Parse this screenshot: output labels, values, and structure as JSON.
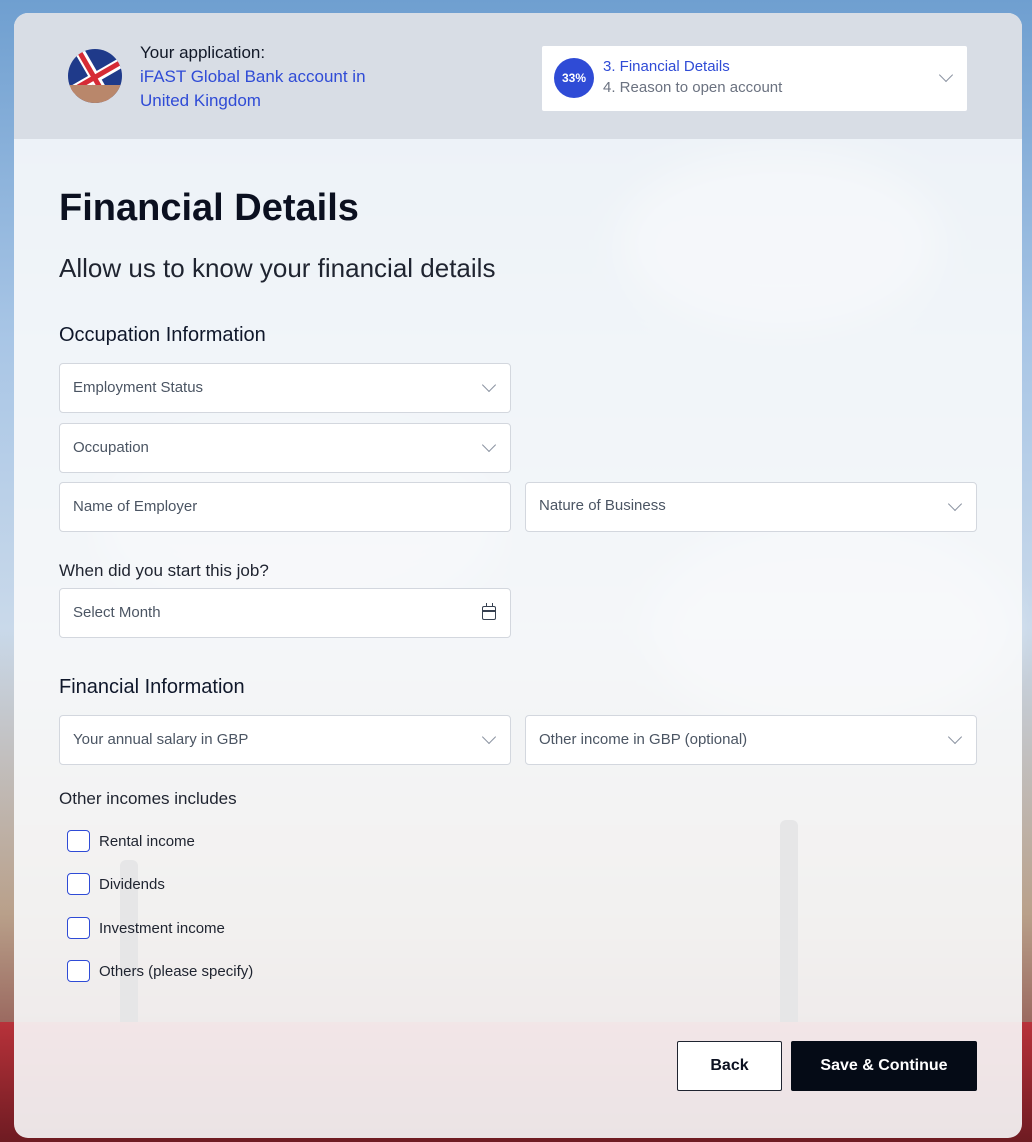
{
  "header": {
    "application_label": "Your application:",
    "application_name": "iFAST Global Bank account in United Kingdom",
    "progress": {
      "percent_label": "33%",
      "percent": 33,
      "current_step": "3. Financial Details",
      "next_step": "4. Reason to open account"
    }
  },
  "main": {
    "title": "Financial Details",
    "subtitle": "Allow us to know your financial details",
    "occupation_section": {
      "title": "Occupation Information",
      "employment_status_placeholder": "Employment Status",
      "occupation_placeholder": "Occupation",
      "employer_placeholder": "Name of Employer",
      "nature_of_business_placeholder": "Nature of Business",
      "start_job_question": "When did you start this job?",
      "select_month_placeholder": "Select Month"
    },
    "financial_section": {
      "title": "Financial Information",
      "annual_salary_placeholder": "Your annual salary in GBP",
      "other_income_placeholder": "Other income in GBP (optional)",
      "other_incomes_label": "Other incomes includes",
      "options": [
        {
          "label": "Rental income",
          "checked": false
        },
        {
          "label": "Dividends",
          "checked": false
        },
        {
          "label": "Investment income",
          "checked": false
        },
        {
          "label": "Others (please specify)",
          "checked": false
        }
      ]
    }
  },
  "actions": {
    "back_label": "Back",
    "save_label": "Save & Continue"
  },
  "colors": {
    "accent": "#2f4bd6",
    "primary_button": "#050b16"
  },
  "icons": [
    "uk-flag-icon",
    "chevron-down-icon",
    "calendar-icon"
  ]
}
